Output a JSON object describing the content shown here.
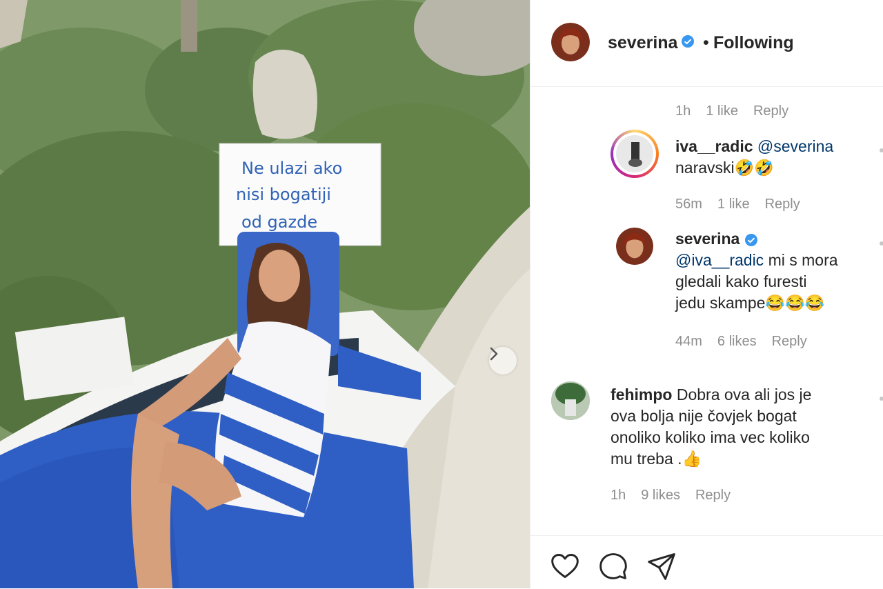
{
  "post": {
    "author": "severina",
    "follow_separator": "•",
    "follow_status": "Following",
    "sign_text": [
      "Ne ulazi ako",
      "nisi bogatiji",
      "od gazde"
    ]
  },
  "comments": {
    "c0_meta": {
      "time": "1h",
      "likes": "1 like",
      "reply": "Reply"
    },
    "c1": {
      "user": "iva__radic",
      "mention": "@severina",
      "text": "naravski🤣🤣",
      "time": "56m",
      "likes": "1 like",
      "reply": "Reply"
    },
    "c2": {
      "user": "severina",
      "mention": "@iva__radic",
      "line1": " mi s mora",
      "line2": "gledali kako furesti",
      "line3": "jedu skampe😂😂😂",
      "time": "44m",
      "likes": "6 likes",
      "reply": "Reply"
    },
    "c3": {
      "user": "fehimpo",
      "line1": " Dobra ova ali jos je",
      "line2": "ova bolja nije čovjek bogat",
      "line3": "onoliko koliko ima vec koliko",
      "line4": "mu treba .👍",
      "time": "1h",
      "likes": "9 likes",
      "reply": "Reply"
    }
  },
  "icons": {
    "verified": "verified-badge-icon",
    "like": "heart-icon",
    "comment": "comment-bubble-icon",
    "share": "paper-plane-icon",
    "next": "chevron-right-icon"
  },
  "colors": {
    "verified": "#3897f0",
    "mention": "#00376b",
    "meta": "#8e8e8e"
  }
}
